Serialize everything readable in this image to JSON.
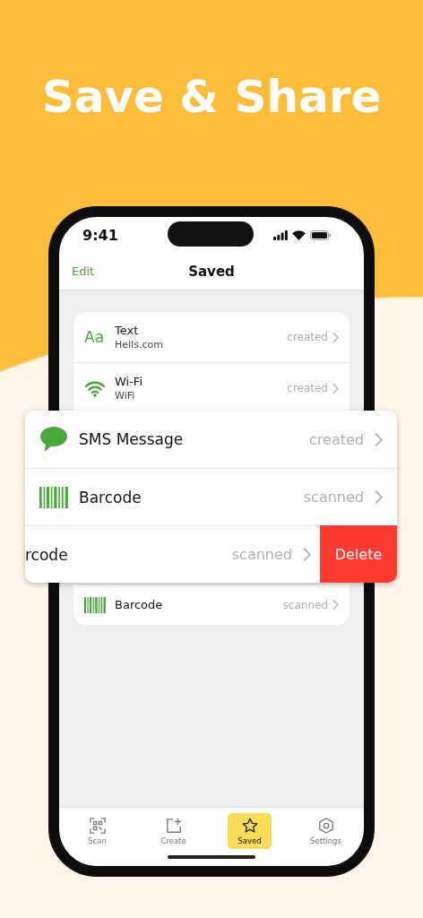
{
  "headline": "Save & Share",
  "phone": {
    "time": "9:41",
    "nav": {
      "edit": "Edit",
      "title": "Saved"
    },
    "list": [
      {
        "kind": "text",
        "glyph": "Aa",
        "title": "Text",
        "subtitle": "Hells.com",
        "status": "created"
      },
      {
        "kind": "wifi",
        "title": "Wi-Fi",
        "subtitle": "WiFi",
        "status": "created"
      },
      {
        "kind": "hidden"
      },
      {
        "kind": "barcode",
        "title": "Barcode",
        "status": "scanned"
      }
    ],
    "tabs": [
      {
        "kind": "scan",
        "label": "Scan",
        "selected": false
      },
      {
        "kind": "create",
        "label": "Create",
        "selected": false
      },
      {
        "kind": "star",
        "label": "Saved",
        "selected": true
      },
      {
        "kind": "settings",
        "label": "Settings",
        "selected": false
      }
    ]
  },
  "overlay": {
    "rows": [
      {
        "kind": "sms",
        "title": "SMS Message",
        "status": "created",
        "swiped": false
      },
      {
        "kind": "barcode",
        "title": "Barcode",
        "status": "scanned",
        "swiped": false
      },
      {
        "kind": "none",
        "title": "rcode",
        "status": "scanned",
        "swiped": true,
        "action": "Delete"
      }
    ]
  }
}
